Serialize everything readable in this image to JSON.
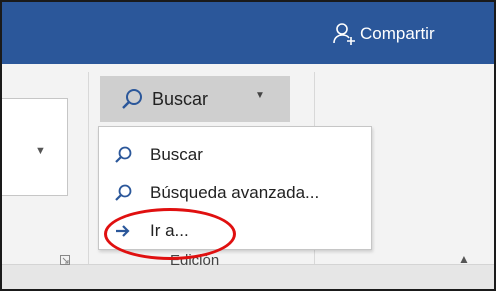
{
  "header": {
    "share_label": "Compartir"
  },
  "search_button": {
    "label": "Buscar"
  },
  "find_menu": {
    "items": [
      {
        "label": "Buscar",
        "icon": "search-icon"
      },
      {
        "label": "Búsqueda avanzada...",
        "icon": "search-icon"
      },
      {
        "label": "Ir a...",
        "icon": "arrow-right-icon"
      }
    ]
  },
  "group": {
    "label": "Edición"
  },
  "colors": {
    "title_bar": "#2b579a",
    "accent_icon": "#2b579a",
    "highlight": "#e01010"
  }
}
